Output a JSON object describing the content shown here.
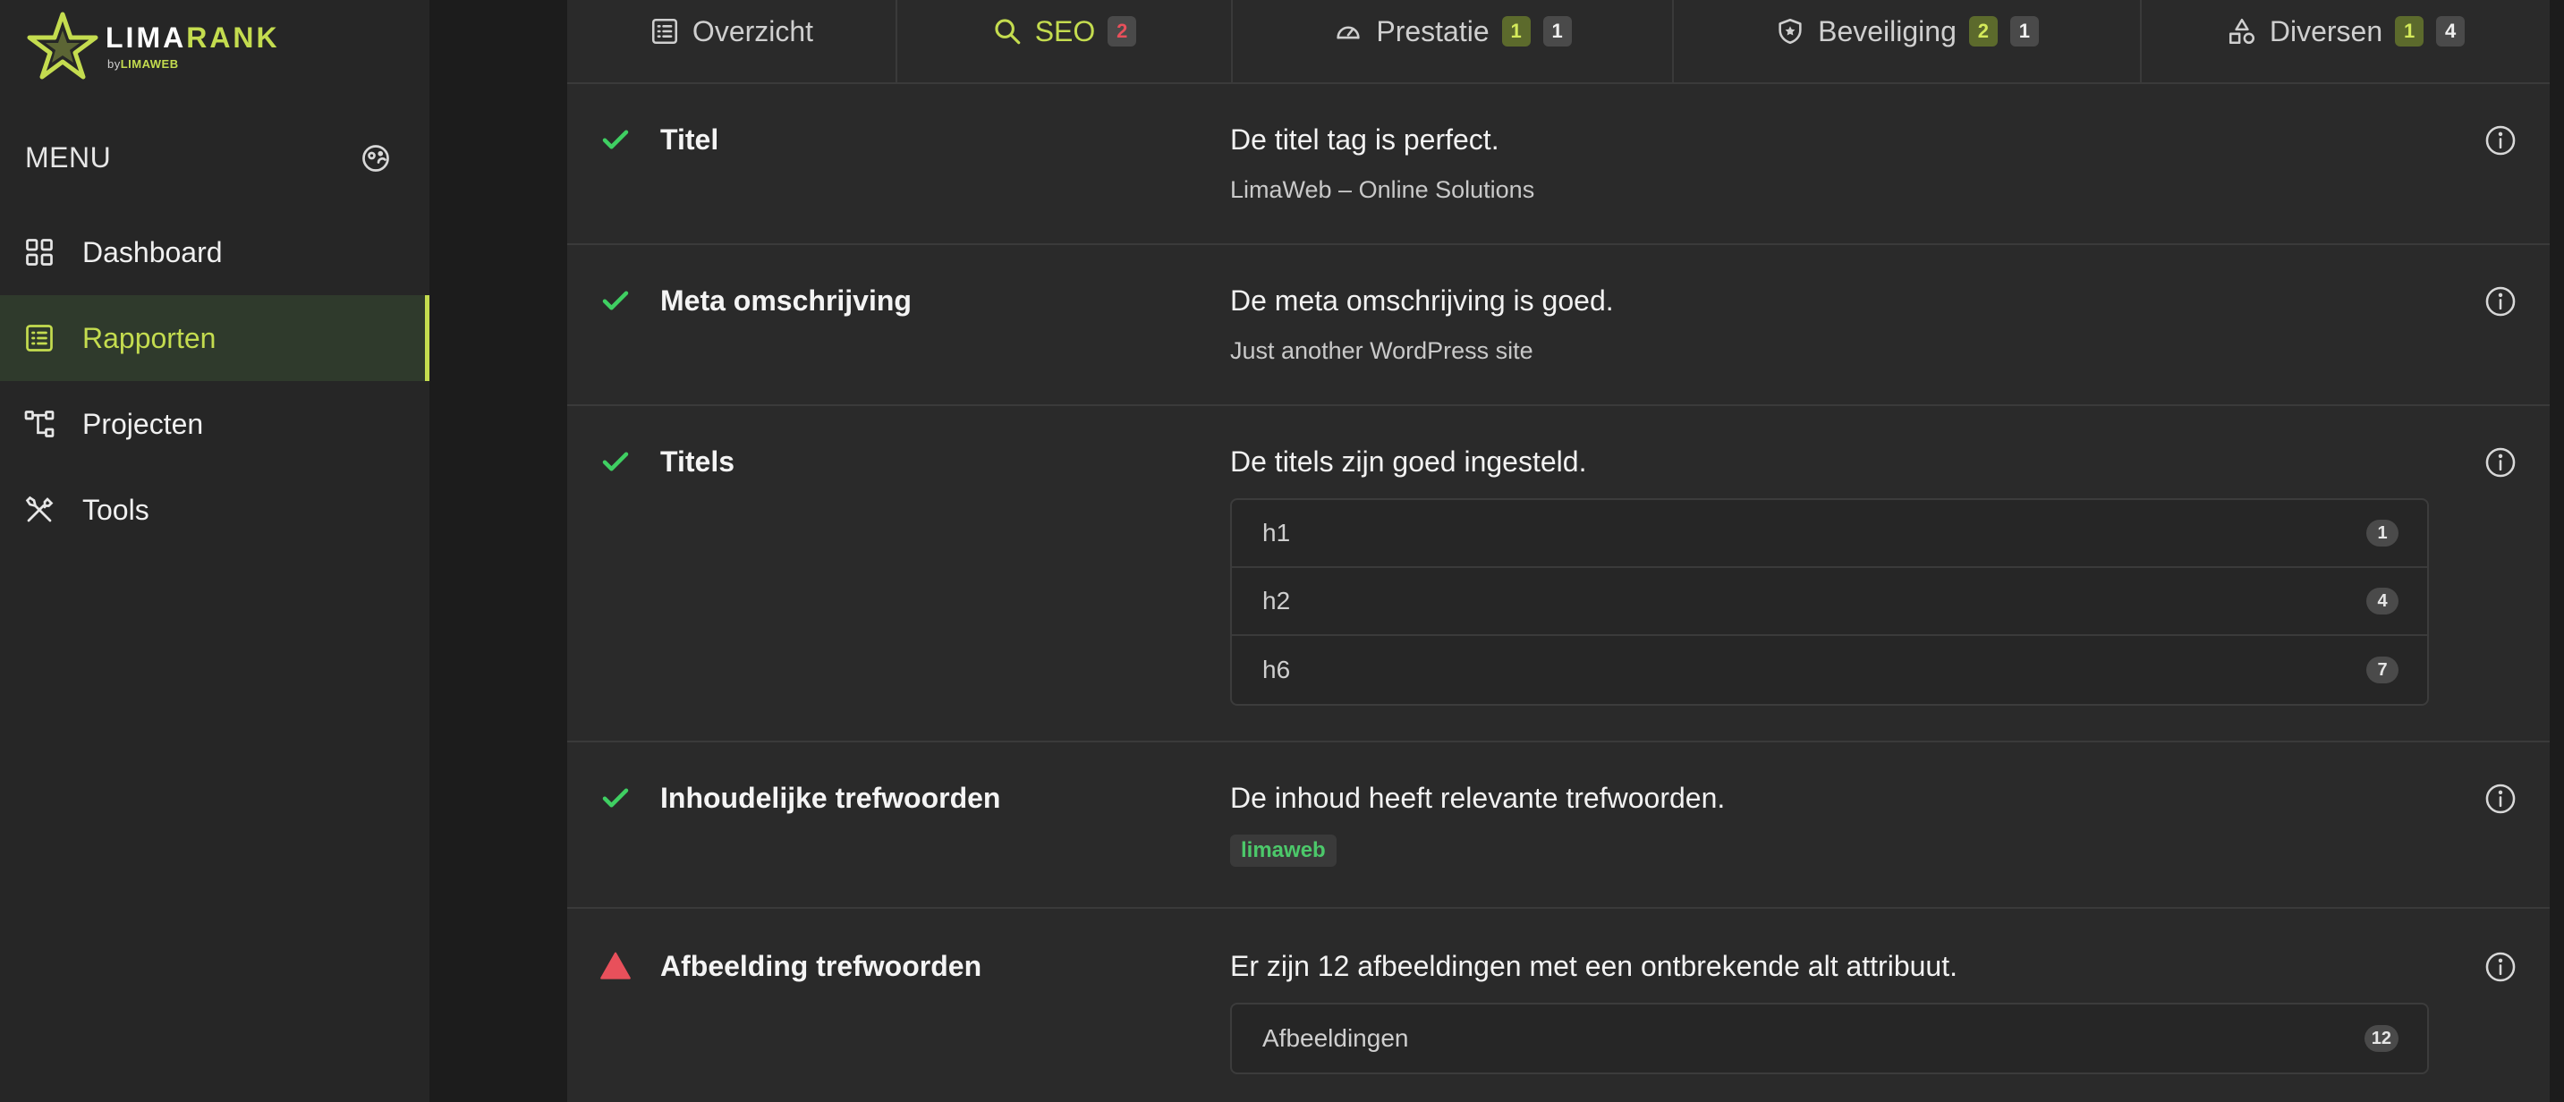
{
  "brand": {
    "name_part1": "LIMA",
    "name_part2": "RANK",
    "sub_prefix": "by",
    "sub_brand": "LIMAWEB",
    "accent": "#c4dc4f"
  },
  "sidebar": {
    "menu_title": "MENU",
    "menu_icon": "palette-icon",
    "items": [
      {
        "label": "Dashboard",
        "icon": "grid-icon",
        "active": false
      },
      {
        "label": "Rapporten",
        "icon": "list-icon",
        "active": true
      },
      {
        "label": "Projecten",
        "icon": "tree-icon",
        "active": false
      },
      {
        "label": "Tools",
        "icon": "tools-icon",
        "active": false
      }
    ]
  },
  "tabs": [
    {
      "label": "Overzicht",
      "icon": "list-icon",
      "active": false,
      "badges": []
    },
    {
      "label": "SEO",
      "icon": "search-icon",
      "active": true,
      "badges": [
        {
          "value": "2",
          "kind": "red"
        }
      ]
    },
    {
      "label": "Prestatie",
      "icon": "gauge-icon",
      "active": false,
      "badges": [
        {
          "value": "1",
          "kind": "green"
        },
        {
          "value": "1",
          "kind": "gray"
        }
      ]
    },
    {
      "label": "Beveiliging",
      "icon": "shield-icon",
      "active": false,
      "badges": [
        {
          "value": "2",
          "kind": "green"
        },
        {
          "value": "1",
          "kind": "gray"
        }
      ]
    },
    {
      "label": "Diversen",
      "icon": "shapes-icon",
      "active": false,
      "badges": [
        {
          "value": "1",
          "kind": "green"
        },
        {
          "value": "4",
          "kind": "gray"
        }
      ]
    }
  ],
  "checks": [
    {
      "status": "pass",
      "title": "Titel",
      "message": "De titel tag is perfect.",
      "detail": "LimaWeb – Online Solutions"
    },
    {
      "status": "pass",
      "title": "Meta omschrijving",
      "message": "De meta omschrijving is goed.",
      "detail": "Just another WordPress site"
    },
    {
      "status": "pass",
      "title": "Titels",
      "message": "De titels zijn goed ingesteld.",
      "list": [
        {
          "label": "h1",
          "count": "1"
        },
        {
          "label": "h2",
          "count": "4"
        },
        {
          "label": "h6",
          "count": "7"
        }
      ]
    },
    {
      "status": "pass",
      "title": "Inhoudelijke trefwoorden",
      "message": "De inhoud heeft relevante trefwoorden.",
      "tag": "limaweb"
    },
    {
      "status": "fail",
      "title": "Afbeelding trefwoorden",
      "message": "Er zijn 12 afbeeldingen met een ontbrekende alt attribuut.",
      "list": [
        {
          "label": "Afbeeldingen",
          "count": "12"
        }
      ]
    }
  ],
  "colors": {
    "pass": "#3fcf62",
    "fail": "#e8505b",
    "active_tab": "#c4dc4f"
  }
}
